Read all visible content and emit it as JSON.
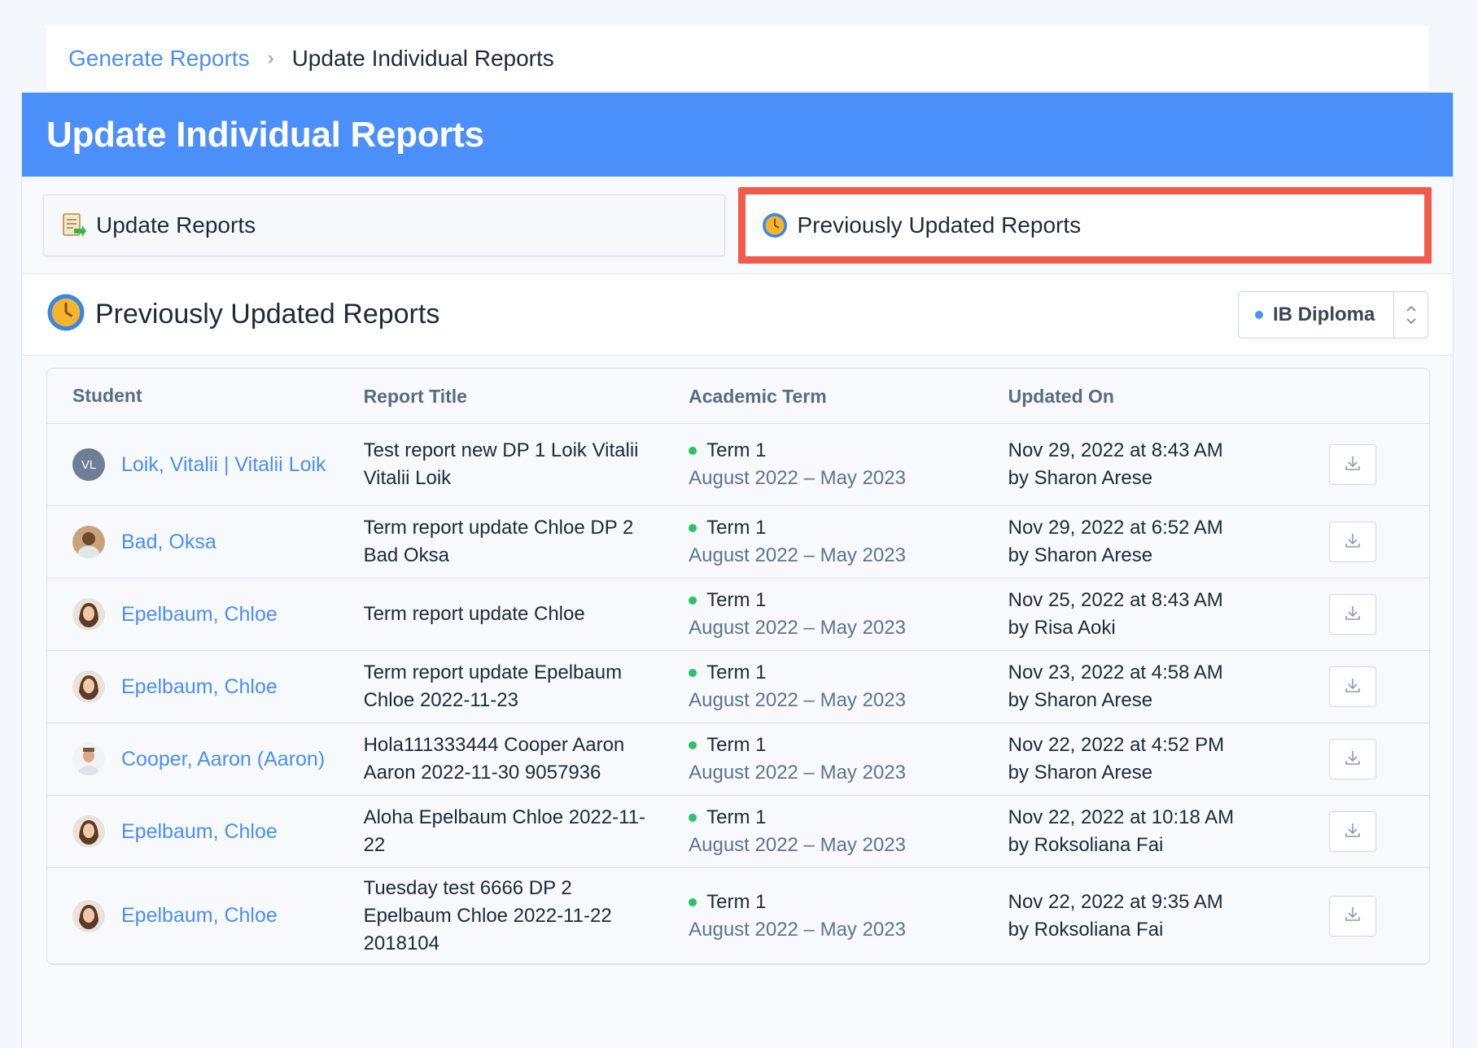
{
  "breadcrumb": {
    "parent": "Generate Reports",
    "separator": "›",
    "current": "Update Individual Reports"
  },
  "panel": {
    "title": "Update Individual Reports"
  },
  "tabs": {
    "update_label": "Update Reports",
    "previous_label": "Previously Updated Reports",
    "highlighted_color": "#f25a4d"
  },
  "section": {
    "title": "Previously Updated Reports",
    "program_select": "IB Diploma"
  },
  "table": {
    "headers": {
      "student": "Student",
      "title": "Report Title",
      "term": "Academic Term",
      "updated": "Updated On"
    },
    "rows": [
      {
        "student": "Loik, Vitalii | Vitalii Loik",
        "avatar": "VL",
        "title1": "Test report new DP 1 Loik Vitalii",
        "title2": "Vitalii Loik",
        "title3": "",
        "term": "Term 1",
        "range": "August 2022 – May 2023",
        "date": "Nov 29, 2022 at 8:43 AM",
        "by": "by Sharon Arese"
      },
      {
        "student": "Bad, Oksa",
        "avatar": "",
        "title1": "Term report update Chloe DP 2",
        "title2": "Bad Oksa",
        "title3": "",
        "term": "Term 1",
        "range": "August 2022 – May 2023",
        "date": "Nov 29, 2022 at 6:52 AM",
        "by": "by Sharon Arese"
      },
      {
        "student": "Epelbaum, Chloe",
        "avatar": "",
        "title1": "Term report update Chloe",
        "title2": "",
        "title3": "",
        "term": "Term 1",
        "range": "August 2022 – May 2023",
        "date": "Nov 25, 2022 at 8:43 AM",
        "by": "by Risa Aoki"
      },
      {
        "student": "Epelbaum, Chloe",
        "avatar": "",
        "title1": "Term report update Epelbaum",
        "title2": "Chloe 2022-11-23",
        "title3": "",
        "term": "Term 1",
        "range": "August 2022 – May 2023",
        "date": "Nov 23, 2022 at 4:58 AM",
        "by": "by Sharon Arese"
      },
      {
        "student": "Cooper, Aaron (Aaron)",
        "avatar": "",
        "title1": "Hola111333444 Cooper Aaron",
        "title2": "Aaron 2022-11-30 9057936",
        "title3": "",
        "term": "Term 1",
        "range": "August 2022 – May 2023",
        "date": "Nov 22, 2022 at 4:52 PM",
        "by": "by Sharon Arese"
      },
      {
        "student": "Epelbaum, Chloe",
        "avatar": "",
        "title1": "Aloha Epelbaum Chloe 2022-11-",
        "title2": "22",
        "title3": "",
        "term": "Term 1",
        "range": "August 2022 – May 2023",
        "date": "Nov 22, 2022 at 10:18 AM",
        "by": "by Roksoliana Fai"
      },
      {
        "student": "Epelbaum, Chloe",
        "avatar": "",
        "title1": "Tuesday test 6666 DP 2",
        "title2": "Epelbaum Chloe 2022-11-22",
        "title3": "2018104",
        "term": "Term 1",
        "range": "August 2022 – May 2023",
        "date": "Nov 22, 2022 at 9:35 AM",
        "by": "by Roksoliana Fai"
      }
    ]
  }
}
